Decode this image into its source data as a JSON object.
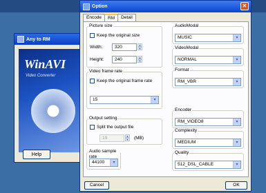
{
  "bg_window": {
    "title": "Any to RM",
    "splash_logo": "WinAVI",
    "splash_sub": "Video Converter",
    "help_label": "Help"
  },
  "dialog": {
    "title": "Option",
    "close_glyph": "✕",
    "tabs": [
      {
        "label": "Encode"
      },
      {
        "label": "RM"
      },
      {
        "label": "Detail"
      }
    ],
    "picture_size": {
      "title": "Picture size",
      "keep_label": "Keep the original size",
      "width_label": "Width:",
      "width_value": "320",
      "height_label": "Height:",
      "height_value": "240"
    },
    "frame_rate": {
      "title": "Video frame rate",
      "keep_label": "Keep the original frame rate",
      "value": "15"
    },
    "output_setting": {
      "title": "Output setting",
      "split_label": "Split the output file",
      "split_value": "10",
      "unit": "(MB)"
    },
    "audio_rate": {
      "title": "Audio sample rate",
      "value": "44100"
    },
    "audio_modal": {
      "label": "AudioModal",
      "value": "MUSIC"
    },
    "video_modal": {
      "label": "VideoModal",
      "value": "NORMAL"
    },
    "format": {
      "label": "Format",
      "value": "RM_VBR"
    },
    "encoder": {
      "label": "Encoder",
      "value": "RM_VIDEO8"
    },
    "complexity": {
      "label": "Complexity",
      "value": "MEDIUM"
    },
    "quality": {
      "label": "Quality",
      "value": "512_DSL_CABLE"
    },
    "cancel_label": "Cancel",
    "ok_label": "OK",
    "dropdown_glyph": "▾",
    "spin_up": "▲",
    "spin_down": "▼"
  },
  "colors": {
    "desktop": "#3b6ea5",
    "titlebar": "#0b45d0",
    "dialog_bg": "#ece9d8"
  }
}
